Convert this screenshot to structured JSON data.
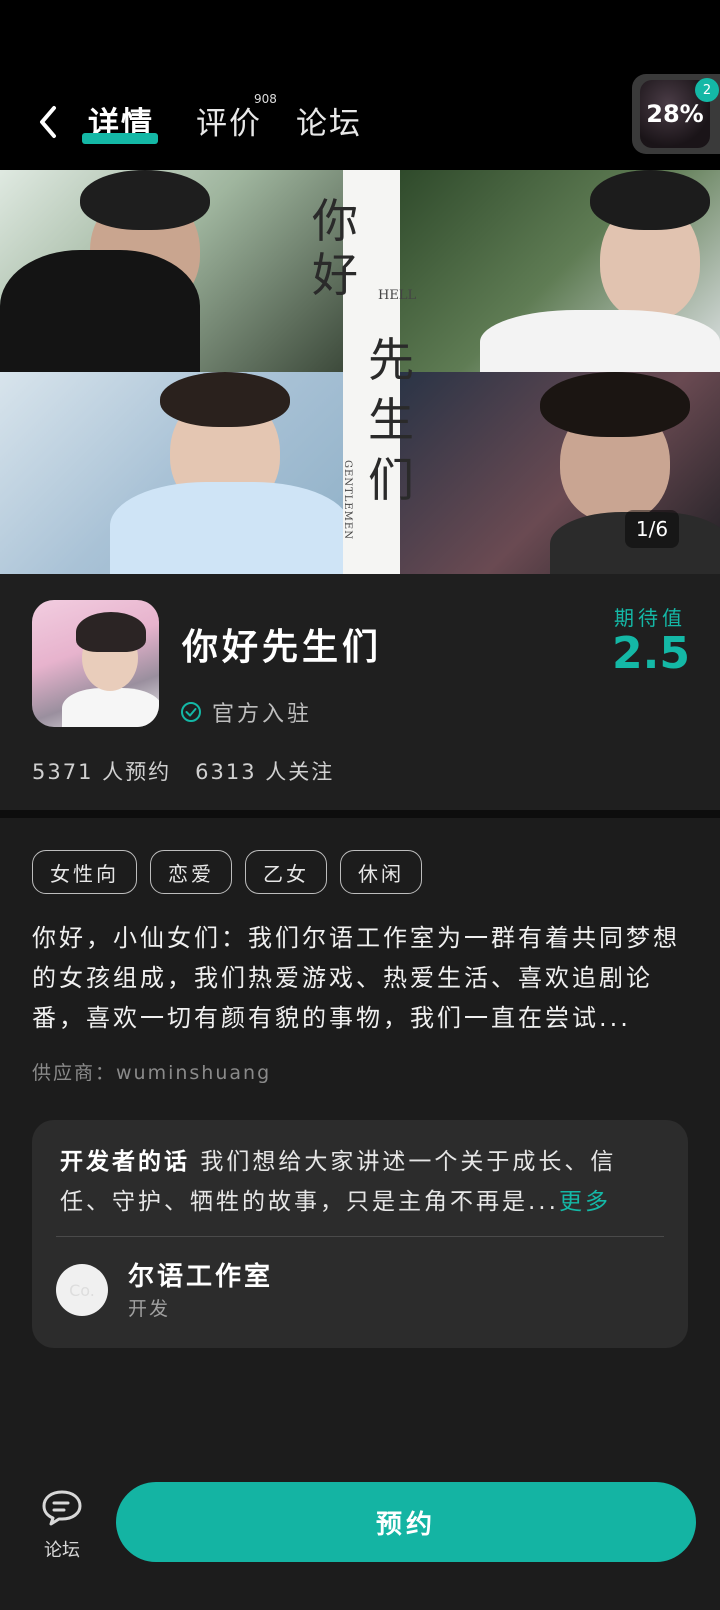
{
  "header": {
    "tabs": [
      {
        "label": "详情",
        "active": true
      },
      {
        "label": "评价",
        "count": "908"
      },
      {
        "label": "论坛"
      }
    ],
    "download": {
      "percent": "28%",
      "badge": "2"
    }
  },
  "banner": {
    "title_top": "你好",
    "title_bottom": "先生们",
    "hello_text": "HELL",
    "gentlemen_text": "GENTLEMEN",
    "page_indicator": "1/6"
  },
  "app": {
    "name": "你好先生们",
    "official_label": "官方入驻",
    "reservations": "5371 人预约",
    "follows": "6313 人关注",
    "expectation_label": "期待值",
    "expectation_value": "2.5"
  },
  "tags": [
    "女性向",
    "恋爱",
    "乙女",
    "休闲"
  ],
  "description": "你好，小仙女们：我们尔语工作室为一群有着共同梦想的女孩组成，我们热爱游戏、热爱生活、喜欢追剧论番，喜欢一切有颜有貌的事物，我们一直在尝试...",
  "supplier": "供应商：wuminshuang",
  "developer": {
    "heading": "开发者的话",
    "text": "我们想给大家讲述一个关于成长、信任、守护、牺牲的故事，只是主角不再是...",
    "more": "更多",
    "studio_name": "尔语工作室",
    "studio_role": "开发",
    "avatar_text": "Co."
  },
  "bottom": {
    "forum_label": "论坛",
    "reserve_label": "预约"
  },
  "colors": {
    "accent": "#14b8a6",
    "background": "#1c1c1c"
  }
}
